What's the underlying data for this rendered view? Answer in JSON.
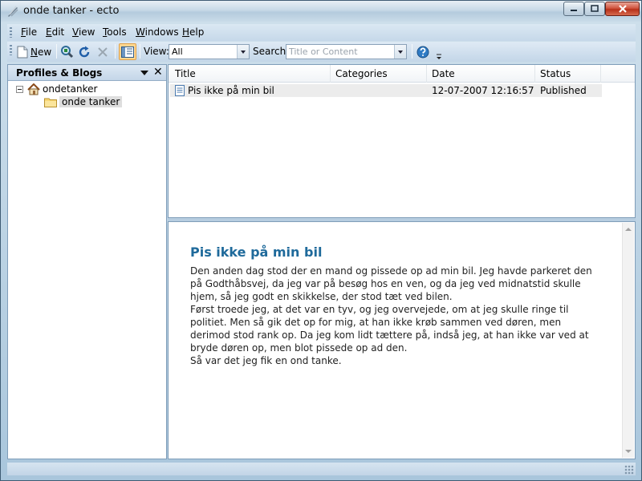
{
  "window": {
    "title": "onde tanker - ecto"
  },
  "menu": {
    "items": [
      {
        "label": "File",
        "mnemonic": "F",
        "rest": "ile"
      },
      {
        "label": "Edit",
        "mnemonic": "E",
        "rest": "dit"
      },
      {
        "label": "View",
        "mnemonic": "V",
        "rest": "iew"
      },
      {
        "label": "Tools",
        "mnemonic": "T",
        "rest": "ools"
      },
      {
        "label": "Windows",
        "mnemonic": "W",
        "rest": "indows"
      },
      {
        "label": "Help",
        "mnemonic": "H",
        "rest": "elp"
      }
    ]
  },
  "toolbar": {
    "new_mnemonic": "N",
    "new_rest": "ew",
    "view_label": "View:",
    "view_value": "All",
    "search_label": "Search:",
    "search_placeholder": "Title or Content"
  },
  "sidebar": {
    "title": "Profiles & Blogs",
    "profile": "ondetanker",
    "blog": "onde tanker"
  },
  "postlist": {
    "columns": [
      "Title",
      "Categories",
      "Date",
      "Status"
    ],
    "rows": [
      {
        "title": "Pis ikke på min bil",
        "categories": "",
        "date": "12-07-2007 12:16:57",
        "status": "Published"
      }
    ]
  },
  "preview": {
    "title": "Pis ikke på min bil",
    "paragraphs": [
      "Den anden dag stod der en mand og pissede op ad min bil. Jeg havde parkeret den på Godthåbsvej, da jeg var på besøg hos en ven, og da jeg ved midnatstid skulle hjem, så jeg godt en skikkelse, der stod tæt ved bilen.",
      "Først troede jeg, at det var en tyv, og jeg overvejede, om at jeg skulle ringe til politiet. Men så gik det op for mig, at han ikke krøb sammen ved døren, men derimod stod rank op. Da jeg kom lidt tættere på, indså jeg, at han ikke var ved at bryde døren op, men blot pissede op ad den.",
      "Så var det jeg fik en ond tanke."
    ]
  },
  "colors": {
    "accent_title": "#1f6a9b",
    "frame": "#a9c6dc",
    "close_button": "#c13a22"
  },
  "icons": [
    "app-icon",
    "minimize-icon",
    "maximize-icon",
    "close-icon",
    "new-document-icon",
    "find-icon",
    "refresh-icon",
    "delete-icon",
    "layout-icon",
    "help-icon",
    "overflow-icon",
    "home-icon",
    "folder-icon",
    "post-icon",
    "panel-menu-icon"
  ]
}
